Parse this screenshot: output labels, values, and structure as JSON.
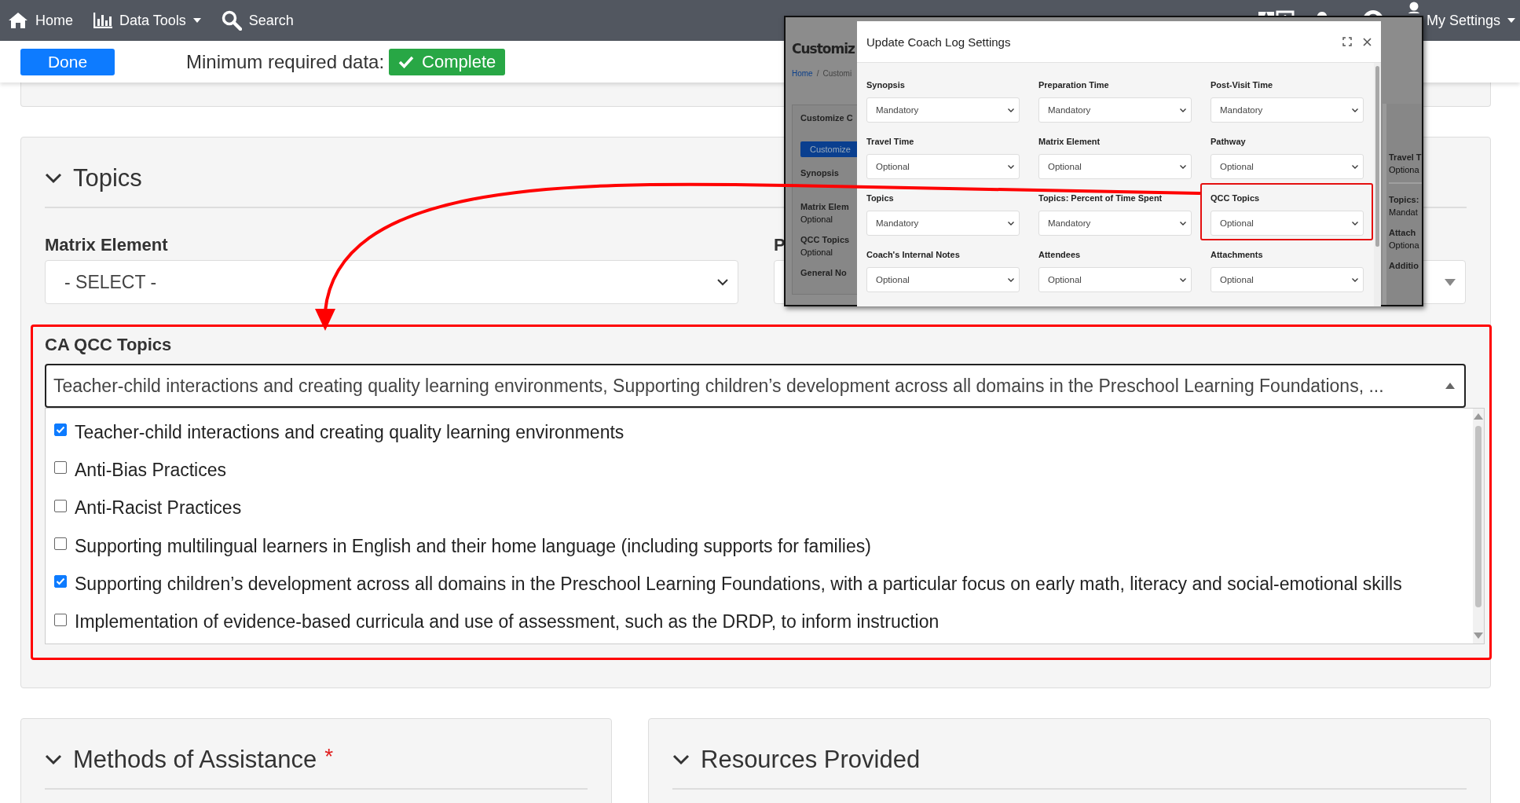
{
  "navbar": {
    "left": [
      "Home",
      "Data Tools",
      "Search"
    ],
    "right": [
      "My Settings"
    ]
  },
  "toolbar": {
    "done": "Done",
    "min_label": "Minimum required data:",
    "status": "Complete"
  },
  "topics_card": {
    "title": "Topics",
    "expanded": true,
    "matrix_label": "Matrix Element",
    "matrix_value": "- SELECT -",
    "col2_label": "P",
    "qcc_label": "CA QCC Topics",
    "qcc_value": "Teacher-child interactions and creating quality learning environments, Supporting children’s development across all domains in the Preschool Learning Foundations, ...",
    "qcc_open": true,
    "options": [
      {
        "label": "Teacher-child interactions and creating quality learning environments",
        "checked": true
      },
      {
        "label": "Anti-Bias Practices",
        "checked": false
      },
      {
        "label": "Anti-Racist Practices",
        "checked": false
      },
      {
        "label": "Supporting multilingual learners in English and their home language (including supports for families)",
        "checked": false
      },
      {
        "label": "Supporting children’s development across all domains in the Preschool Learning Foundations, with a particular focus on early math, literacy and social-emotional skills",
        "checked": true
      },
      {
        "label": "Implementation of evidence-based curricula and use of assessment, such as the DRDP, to inform instruction",
        "checked": false
      }
    ]
  },
  "bottom_cards": [
    {
      "title": "Methods of Assistance",
      "required_mark": "*"
    },
    {
      "title": "Resources Provided"
    }
  ],
  "inset": {
    "page_title": "Customiz",
    "breadcrumb": [
      "Home",
      "Customi"
    ],
    "breadcrumb_separator": "/",
    "card_title": "Customize C",
    "card_button": "Customize",
    "left_fields": [
      {
        "label": "Synopsis"
      },
      {
        "label": "Matrix Elem",
        "value": "Optional"
      },
      {
        "label": "QCC Topics",
        "value": "Optional"
      },
      {
        "label": "General No"
      }
    ],
    "right_fields": [
      {
        "label": "Travel T",
        "value": "Optiona"
      },
      {
        "label": "Topics:",
        "value": "Mandat"
      },
      {
        "label": "Attach",
        "value": "Optiona"
      },
      {
        "label": "Additio"
      }
    ],
    "modal": {
      "title": "Update Coach Log Settings",
      "fields": [
        {
          "label": "Synopsis",
          "value": "Mandatory",
          "highlighted": false
        },
        {
          "label": "Preparation Time",
          "value": "Mandatory",
          "highlighted": false
        },
        {
          "label": "Post-Visit Time",
          "value": "Mandatory",
          "highlighted": false
        },
        {
          "label": "Travel Time",
          "value": "Optional",
          "highlighted": false
        },
        {
          "label": "Matrix Element",
          "value": "Optional",
          "highlighted": false
        },
        {
          "label": "Pathway",
          "value": "Optional",
          "highlighted": false
        },
        {
          "label": "Topics",
          "value": "Mandatory",
          "highlighted": false
        },
        {
          "label": "Topics: Percent of Time Spent",
          "value": "Mandatory",
          "highlighted": false
        },
        {
          "label": "QCC Topics",
          "value": "Optional",
          "highlighted": true
        },
        {
          "label": "Coach's Internal Notes",
          "value": "Optional",
          "highlighted": false
        },
        {
          "label": "Attendees",
          "value": "Optional",
          "highlighted": false
        },
        {
          "label": "Attachments",
          "value": "Optional",
          "highlighted": false
        }
      ]
    }
  }
}
